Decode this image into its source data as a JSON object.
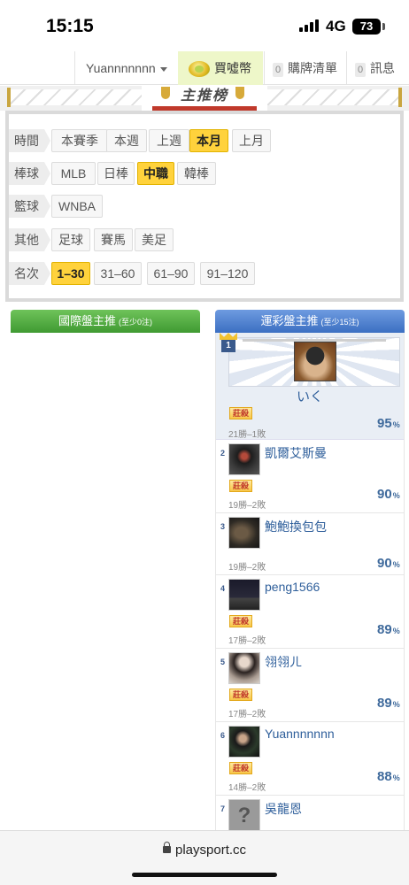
{
  "status": {
    "time": "15:15",
    "network": "4G",
    "battery": "73"
  },
  "nav": {
    "username": "Yuannnnnnn",
    "buy_label": "買噓幣",
    "cart_count": "0",
    "cart_label": "購牌清單",
    "msg_count": "0",
    "msg_label": "訊息"
  },
  "banner": {
    "title": "主推榜"
  },
  "filters": {
    "time": {
      "label": "時間",
      "options": [
        "本賽季",
        "本週",
        "上週",
        "本月",
        "上月"
      ],
      "selected": "本月"
    },
    "baseball": {
      "label": "棒球",
      "options": [
        "MLB",
        "日棒",
        "中職",
        "韓棒"
      ],
      "selected": "中職"
    },
    "basketball": {
      "label": "籃球",
      "options": [
        "WNBA"
      ]
    },
    "other": {
      "label": "其他",
      "options": [
        "足球",
        "賽馬",
        "美足"
      ]
    },
    "rank": {
      "label": "名次",
      "options": [
        "1–30",
        "31–60",
        "61–90",
        "91–120"
      ],
      "selected": "1–30"
    }
  },
  "intl": {
    "title": "國際盤主推",
    "note": "(至少0注)"
  },
  "lottery": {
    "title": "運彩盤主推",
    "note": "(至少15注)",
    "badge": "莊殺",
    "pct_unit": "%",
    "ranks": [
      {
        "rank": "1",
        "name": "いく",
        "record": "21勝–1敗",
        "pct": "95"
      },
      {
        "rank": "2",
        "name": "凱爾艾斯曼",
        "record": "19勝–2敗",
        "pct": "90"
      },
      {
        "rank": "3",
        "name": "鮑鮑換包包",
        "record": "19勝–2敗",
        "pct": "90"
      },
      {
        "rank": "4",
        "name": "peng1566",
        "record": "17勝–2敗",
        "pct": "89"
      },
      {
        "rank": "5",
        "name": "翎翎ㄦ",
        "record": "17勝–2敗",
        "pct": "89"
      },
      {
        "rank": "6",
        "name": "Yuannnnnnn",
        "record": "14勝–2敗",
        "pct": "88"
      },
      {
        "rank": "7",
        "name": "吳龍恩",
        "record": "",
        "pct": ""
      }
    ]
  },
  "browser": {
    "url": "playsport.cc"
  }
}
